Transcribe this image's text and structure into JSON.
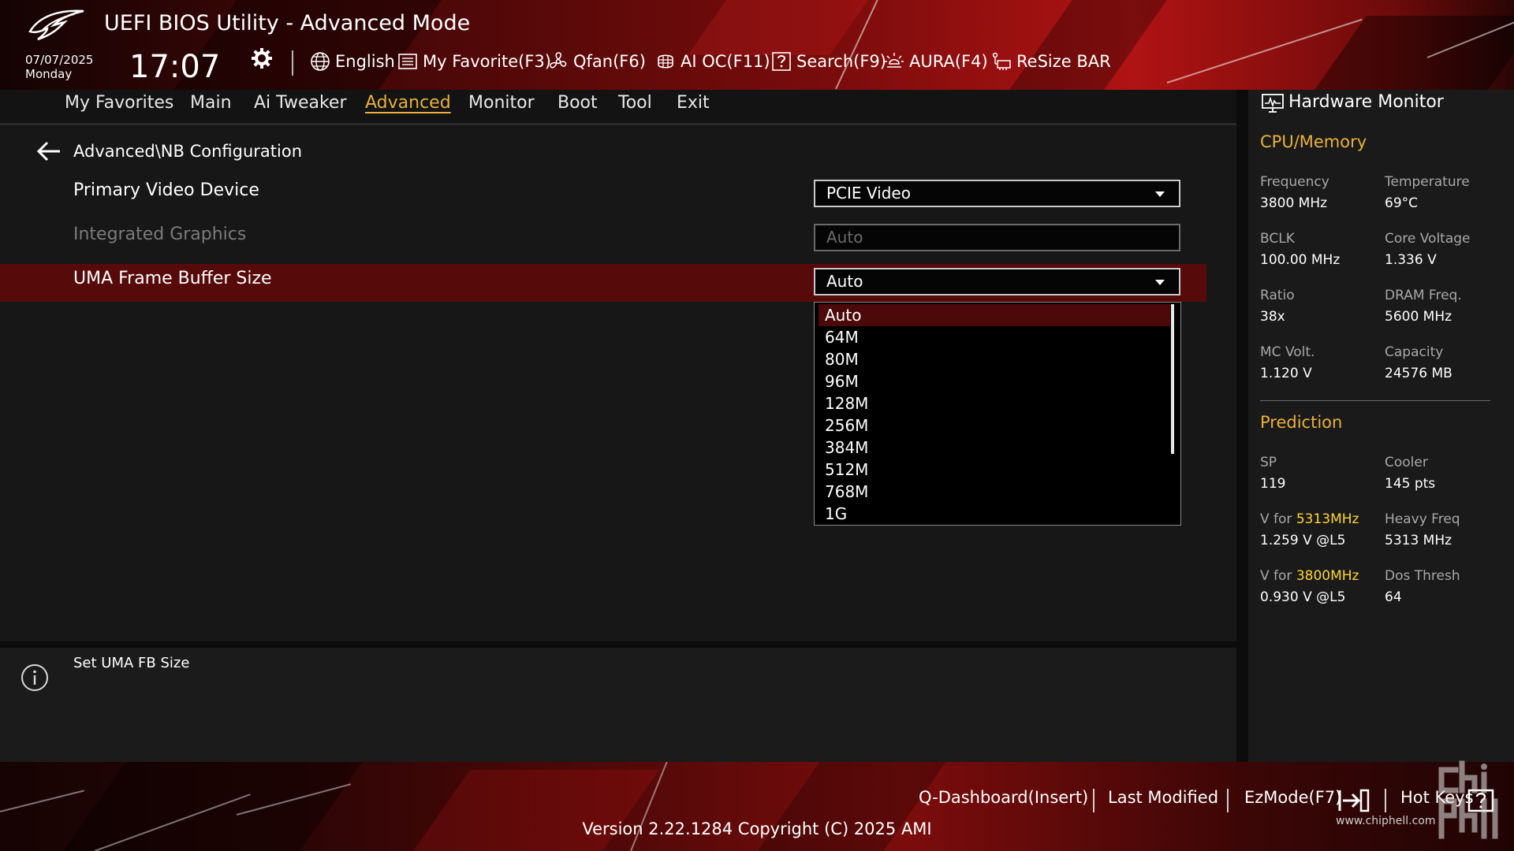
{
  "header": {
    "title": "UEFI BIOS Utility - Advanced Mode",
    "date": "07/07/2025",
    "day": "Monday",
    "time": "17:07",
    "toolbar": [
      {
        "label": "English",
        "icon": "globe-icon"
      },
      {
        "label": "My Favorite(F3)",
        "icon": "favorite-list-icon"
      },
      {
        "label": "Qfan(F6)",
        "icon": "fan-icon"
      },
      {
        "label": "AI OC(F11)",
        "icon": "ai-chip-icon"
      },
      {
        "label": "Search(F9)",
        "icon": "search-question-icon"
      },
      {
        "label": "AURA(F4)",
        "icon": "aura-light-icon"
      },
      {
        "label": "ReSize BAR",
        "icon": "resize-bar-icon"
      }
    ]
  },
  "menu": {
    "items": [
      "My Favorites",
      "Main",
      "Ai Tweaker",
      "Advanced",
      "Monitor",
      "Boot",
      "Tool",
      "Exit"
    ],
    "active": "Advanced"
  },
  "main": {
    "breadcrumb": "Advanced\\NB Configuration",
    "settings": [
      {
        "label": "Primary Video Device",
        "value": "PCIE Video",
        "enabled": true
      },
      {
        "label": "Integrated Graphics",
        "value": "Auto",
        "enabled": false
      },
      {
        "label": "UMA Frame Buffer Size",
        "value": "Auto",
        "enabled": true,
        "highlighted": true
      }
    ],
    "dropdown": {
      "options": [
        "Auto",
        "64M",
        "80M",
        "96M",
        "128M",
        "256M",
        "384M",
        "512M",
        "768M",
        "1G"
      ],
      "selected": "Auto"
    }
  },
  "help": {
    "text": "Set UMA FB Size"
  },
  "hardware_monitor": {
    "title": "Hardware Monitor",
    "cpu_memory": {
      "heading": "CPU/Memory",
      "frequency_label": "Frequency",
      "frequency_value": "3800 MHz",
      "temperature_label": "Temperature",
      "temperature_value": "69°C",
      "bclk_label": "BCLK",
      "bclk_value": "100.00 MHz",
      "core_voltage_label": "Core Voltage",
      "core_voltage_value": "1.336 V",
      "ratio_label": "Ratio",
      "ratio_value": "38x",
      "dram_freq_label": "DRAM Freq.",
      "dram_freq_value": "5600 MHz",
      "mc_volt_label": "MC Volt.",
      "mc_volt_value": "1.120 V",
      "capacity_label": "Capacity",
      "capacity_value": "24576 MB"
    },
    "prediction": {
      "heading": "Prediction",
      "sp_label": "SP",
      "sp_value": "119",
      "cooler_label": "Cooler",
      "cooler_value": "145 pts",
      "v_for_prefix": "V for",
      "v_for_1_freq": "5313MHz",
      "v_for_1_value": "1.259 V @L5",
      "heavy_freq_label": "Heavy Freq",
      "heavy_freq_value": "5313 MHz",
      "v_for_2_freq": "3800MHz",
      "v_for_2_value": "0.930 V @L5",
      "dos_thresh_label": "Dos Thresh",
      "dos_thresh_value": "64"
    }
  },
  "footer": {
    "q_dashboard": "Q-Dashboard(Insert)",
    "last_modified": "Last Modified",
    "ezmode": "EzMode(F7)",
    "hot_keys": "Hot Keys",
    "version": "Version 2.22.1284 Copyright (C) 2025 AMI"
  },
  "watermark": {
    "url": "www.chiphell.com"
  },
  "colors": {
    "accent": "#e9b13b",
    "highlight": "#ffd633",
    "row_highlight": "#570a0a",
    "header_red": "#b01313"
  }
}
